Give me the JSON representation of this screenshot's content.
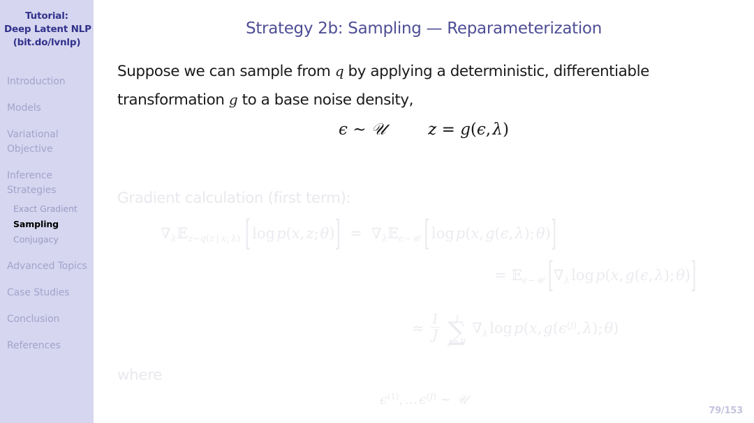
{
  "sidebar": {
    "title_lines": [
      "Tutorial:",
      "Deep Latent NLP",
      "(bit.do/lvnlp)"
    ],
    "sections": [
      {
        "label": "Introduction",
        "lines": [
          "Introduction"
        ]
      },
      {
        "label": "Models",
        "lines": [
          "Models"
        ]
      },
      {
        "label": "Variational Objective",
        "lines": [
          "Variational",
          "Objective"
        ]
      },
      {
        "label": "Inference Strategies",
        "lines": [
          "Inference",
          "Strategies"
        ]
      },
      {
        "label": "Advanced Topics",
        "lines": [
          "Advanced Topics"
        ]
      },
      {
        "label": "Case Studies",
        "lines": [
          "Case Studies"
        ]
      },
      {
        "label": "Conclusion",
        "lines": [
          "Conclusion"
        ]
      },
      {
        "label": "References",
        "lines": [
          "References"
        ]
      }
    ],
    "subsections": [
      {
        "label": "Exact Gradient",
        "active": false
      },
      {
        "label": "Sampling",
        "active": true
      },
      {
        "label": "Conjugacy",
        "active": false
      }
    ],
    "colors": {
      "background": "#d6d6f0",
      "title": "#32328c",
      "item": "#a3a3cb",
      "active_item": "#000000"
    }
  },
  "slide": {
    "title": "Strategy 2b: Sampling — Reparameterization",
    "title_color": "#4e4e95",
    "body_line1_a": "Suppose we can sample from ",
    "body_line1_q": "q",
    "body_line1_b": " by applying a deterministic, differentiable",
    "body_line2_a": "transformation ",
    "body_line2_g": "g",
    "body_line2_b": " to a base noise density,",
    "equation_main_left": "ε ∼ 𝒰",
    "equation_main_right": "z = g(ε, λ)",
    "faded_label_gradient": "Gradient calculation (first term):",
    "faded_label_where": "where",
    "faded_eq_line1": "∇λ Ez∼q(z|x;λ) [ log p(x, z; θ) ] = ∇λ Eε∼𝒰 [ log p(x, g(ε, λ); θ) ]",
    "faded_eq_line2": "= Eε∼𝒰 [ ∇λ log p(x, g(ε, λ); θ) ]",
    "faded_eq_line3": "≈ (1/J) Σ j=1..J ∇λ log p(x, g(ε(j), λ); θ)",
    "faded_eq_line4": "ε(1), … ε(J) ∼ 𝒰",
    "page_number": "79/153"
  }
}
